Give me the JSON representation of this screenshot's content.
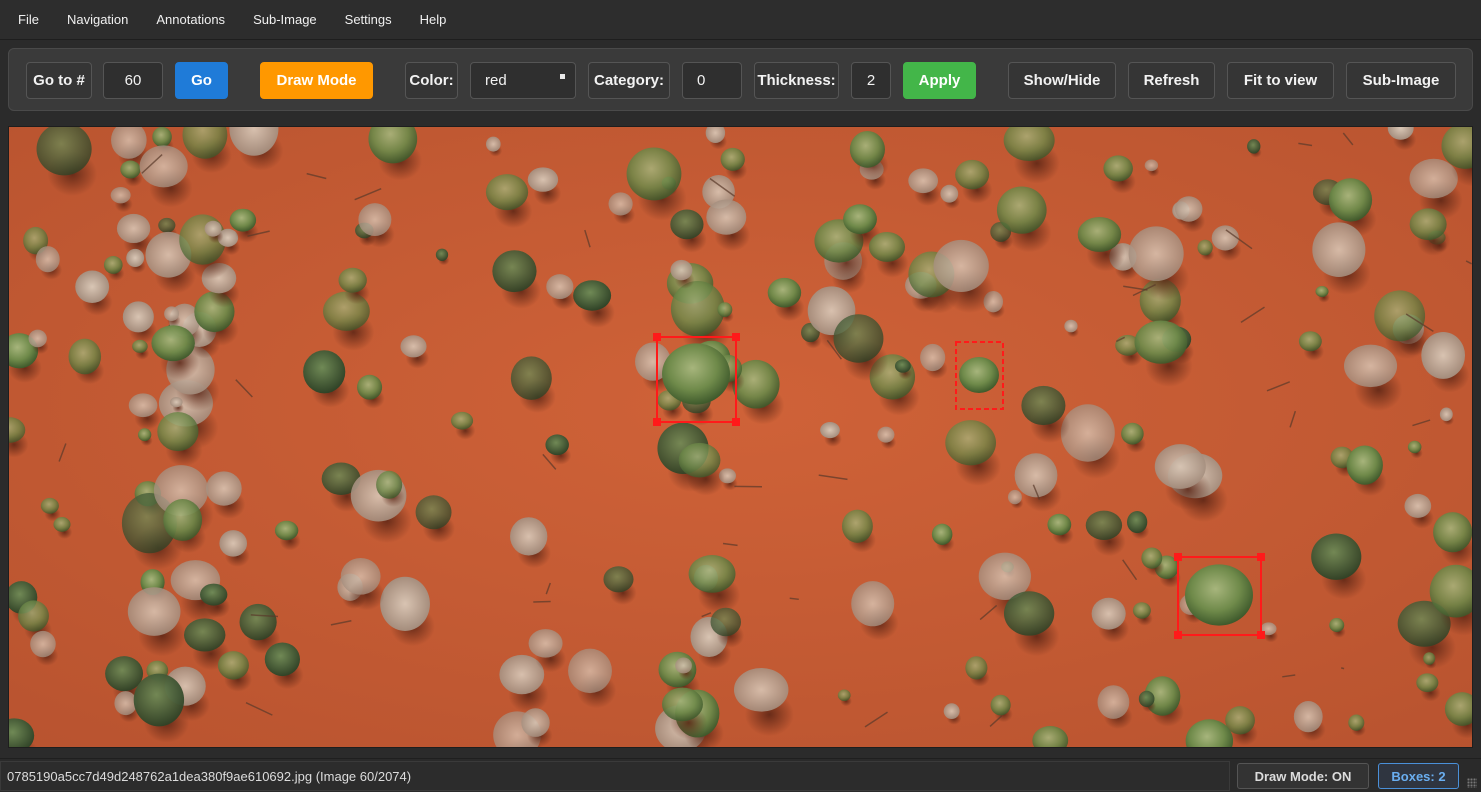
{
  "menu": {
    "items": [
      {
        "label": "File"
      },
      {
        "label": "Navigation"
      },
      {
        "label": "Annotations"
      },
      {
        "label": "Sub-Image"
      },
      {
        "label": "Settings"
      },
      {
        "label": "Help"
      }
    ]
  },
  "toolbar": {
    "goto_label": "Go to #",
    "goto_value": "60",
    "go_button": "Go",
    "draw_mode_button": "Draw Mode",
    "color_label": "Color:",
    "color_value": "red",
    "category_label": "Category:",
    "category_value": "0",
    "thickness_label": "Thickness:",
    "thickness_value": "2",
    "apply_button": "Apply",
    "show_hide_button": "Show/Hide",
    "refresh_button": "Refresh",
    "fit_button": "Fit to view",
    "subimage_button": "Sub-Image"
  },
  "canvas": {
    "image_description_icon": "aerial-photo-icon",
    "box_color": "#ff1a1a",
    "boxes_drawn": 2,
    "pending_boxes": 1
  },
  "status": {
    "file": "0785190a5cc7d49d248762a1dea380f9ae610692.jpg (Image 60/2074)",
    "draw_mode": "Draw Mode: ON",
    "boxes": "Boxes: 2"
  },
  "colors": {
    "go": "#1f7bd8",
    "draw_mode": "#ff9800",
    "apply": "#43b649",
    "soil": "#c45a34"
  }
}
